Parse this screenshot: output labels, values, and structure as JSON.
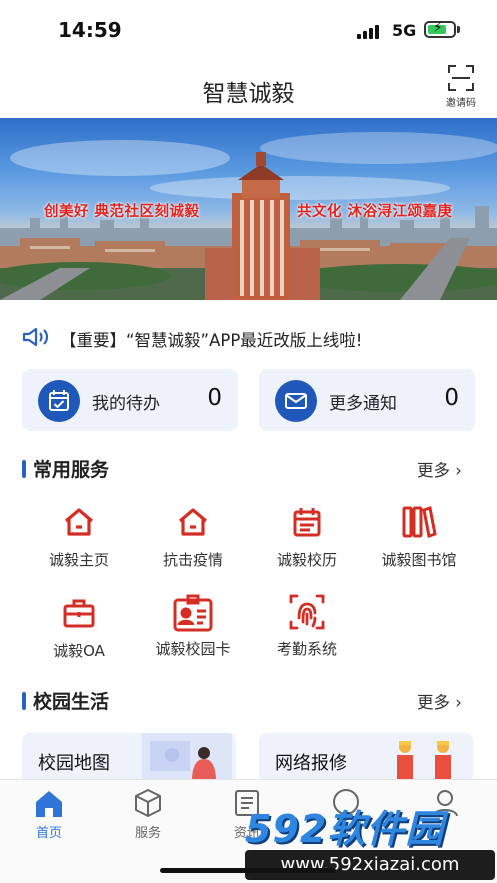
{
  "status_bar": {
    "time": "14:59",
    "network": "5G",
    "battery": "charging"
  },
  "header": {
    "title": "智慧诚毅",
    "invite_label": "邀请码"
  },
  "banner": {
    "slogan_left": "创美好 典范社区刻诚毅",
    "slogan_right": "共文化 沐浴浔江颂嘉庚"
  },
  "notice": {
    "text": "【重要】“智慧诚毅”APP最近改版上线啦!"
  },
  "cards": [
    {
      "label": "我的待办",
      "count": "0",
      "icon": "calendar-check-icon"
    },
    {
      "label": "更多通知",
      "count": "0",
      "icon": "mail-icon"
    }
  ],
  "common_services": {
    "title": "常用服务",
    "more": "更多",
    "items": [
      {
        "label": "诚毅主页",
        "icon": "home-icon"
      },
      {
        "label": "抗击疫情",
        "icon": "home-icon"
      },
      {
        "label": "诚毅校历",
        "icon": "calendar-icon"
      },
      {
        "label": "诚毅图书馆",
        "icon": "books-icon"
      },
      {
        "label": "诚毅OA",
        "icon": "briefcase-icon"
      },
      {
        "label": "诚毅校园卡",
        "icon": "id-card-icon"
      },
      {
        "label": "考勤系统",
        "icon": "fingerprint-icon"
      }
    ]
  },
  "campus_life": {
    "title": "校园生活",
    "more": "更多",
    "items": [
      {
        "label": "校园地图"
      },
      {
        "label": "网络报修"
      }
    ]
  },
  "tabbar": {
    "items": [
      {
        "label": "首页",
        "icon": "home-tab-icon",
        "active": true
      },
      {
        "label": "服务",
        "icon": "cube-icon",
        "active": false
      },
      {
        "label": "资讯",
        "icon": "news-icon",
        "active": false
      },
      {
        "label": "",
        "icon": "message-icon",
        "active": false
      },
      {
        "label": "",
        "icon": "profile-icon",
        "active": false
      }
    ]
  },
  "watermark": {
    "brand": "592软件园",
    "url": "www.592xiazai.com"
  },
  "colors": {
    "accent": "#1f58b8",
    "service_icon": "#d42e24",
    "slogan": "#e0231e"
  }
}
